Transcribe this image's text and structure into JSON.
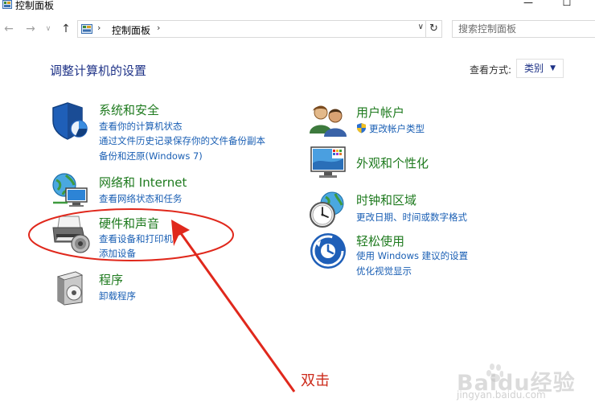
{
  "window": {
    "title": "控制面板",
    "min_glyph": "—",
    "max_glyph": "☐"
  },
  "nav": {
    "back_glyph": "←",
    "forward_glyph": "→",
    "dropdown_glyph": "∨",
    "up_glyph": "↑",
    "breadcrumb": "控制面板",
    "sep_glyph": "›",
    "addr_dropdown_glyph": "∨",
    "refresh_glyph": "↻",
    "search_placeholder": "搜索控制面板"
  },
  "header": {
    "title": "调整计算机的设置",
    "view_by_label": "查看方式:",
    "view_by_value": "类别",
    "caret": "▼"
  },
  "categories": {
    "system": {
      "title": "系统和安全",
      "links": [
        "查看你的计算机状态",
        "通过文件历史记录保存你的文件备份副本",
        "备份和还原(Windows 7)"
      ]
    },
    "network": {
      "title": "网络和 Internet",
      "links": [
        "查看网络状态和任务"
      ]
    },
    "hardware": {
      "title": "硬件和声音",
      "links": [
        "查看设备和打印机",
        "添加设备"
      ]
    },
    "programs": {
      "title": "程序",
      "links": [
        "卸载程序"
      ]
    },
    "users": {
      "title": "用户帐户",
      "links": [
        "更改帐户类型"
      ]
    },
    "appearance": {
      "title": "外观和个性化",
      "links": []
    },
    "clock": {
      "title": "时钟和区域",
      "links": [
        "更改日期、时间或数字格式"
      ]
    },
    "ease": {
      "title": "轻松使用",
      "links": [
        "使用 Windows 建议的设置",
        "优化视觉显示"
      ]
    }
  },
  "annotation": {
    "text": "双击",
    "color": "#cc2a1a"
  },
  "watermark": {
    "text": "Baidu经验",
    "sub": "jingyan.baidu.com"
  },
  "colors": {
    "title_blue": "#1e3287",
    "category_green": "#1e7a1e",
    "link_blue": "#1a5fb4"
  }
}
